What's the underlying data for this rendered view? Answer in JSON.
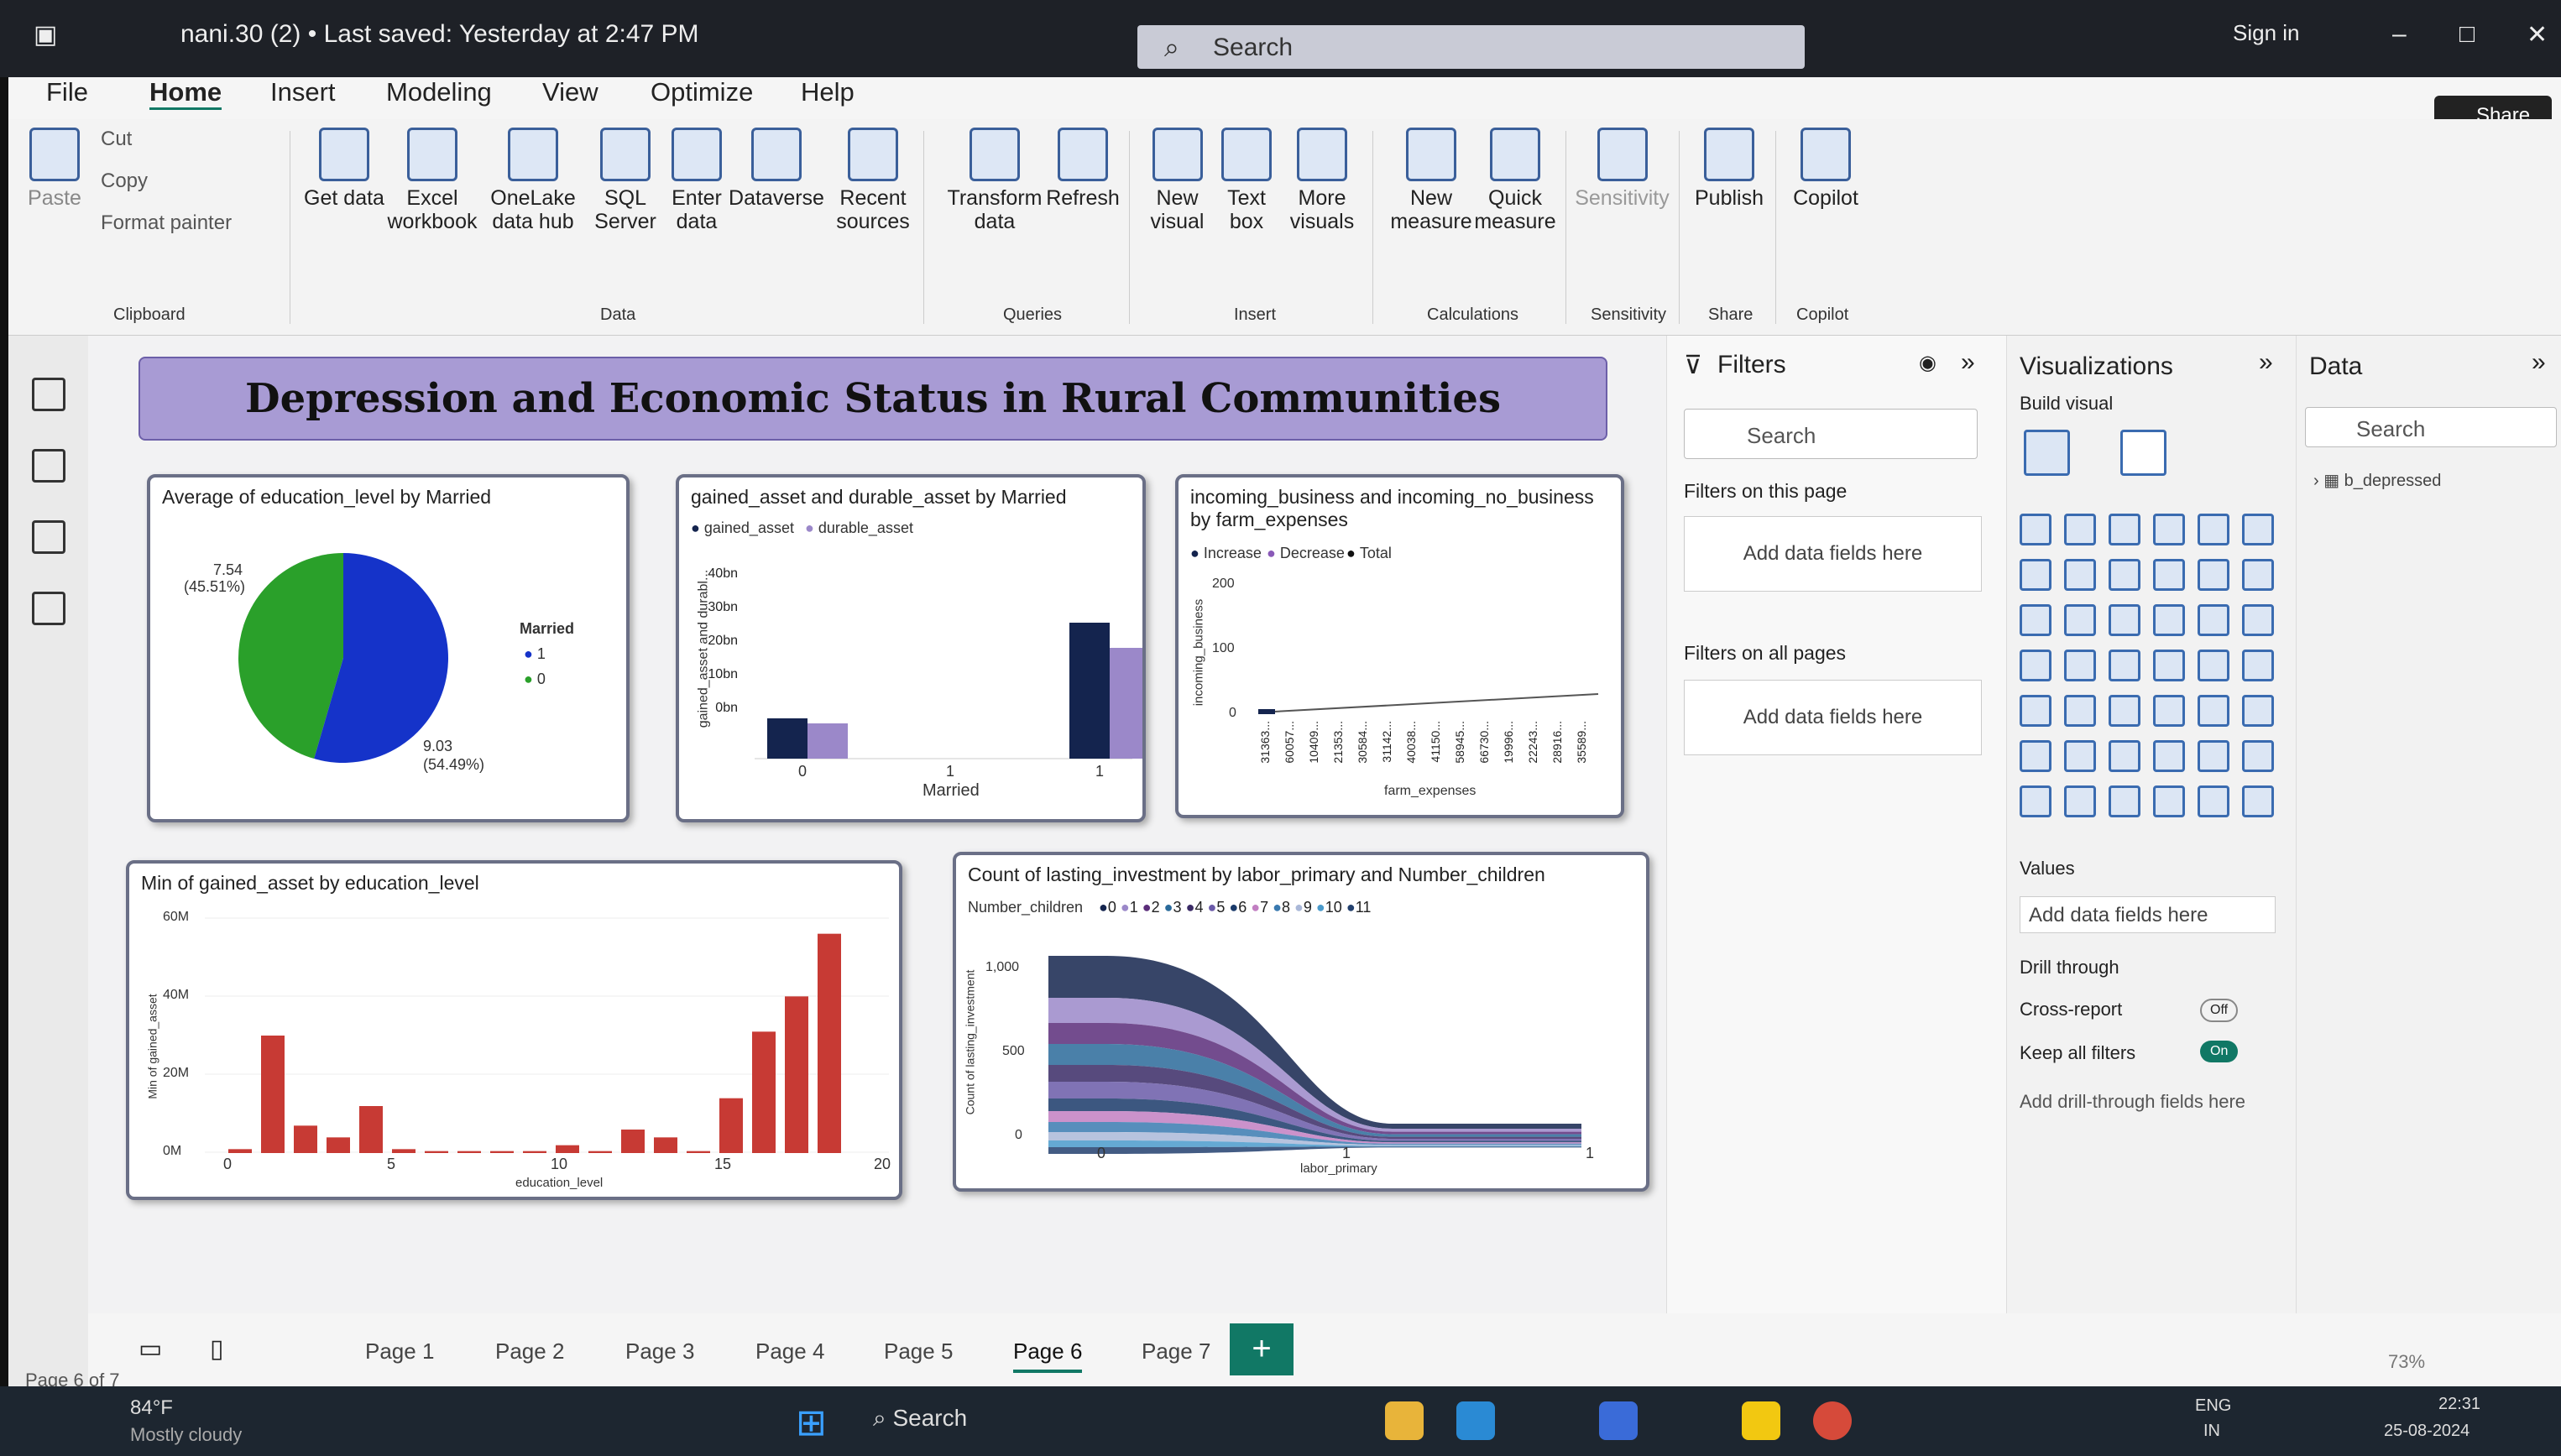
{
  "titlebar": {
    "doc_title": "nani.30 (2) • Last saved: Yesterday at 2:47 PM",
    "search_placeholder": "Search",
    "sign_in": "Sign in"
  },
  "menu": {
    "file": "File",
    "home": "Home",
    "insert": "Insert",
    "modeling": "Modeling",
    "view": "View",
    "optimize": "Optimize",
    "help": "Help",
    "share": "Share"
  },
  "ribbon": {
    "paste": "Paste",
    "cut": "Cut",
    "copy": "Copy",
    "format_painter": "Format painter",
    "clipboard": "Clipboard",
    "get_data": "Get data",
    "excel": "Excel workbook",
    "onelake": "OneLake data hub",
    "sql": "SQL Server",
    "enter_data": "Enter data",
    "dataverse": "Dataverse",
    "recent": "Recent sources",
    "data": "Data",
    "transform": "Transform data",
    "refresh": "Refresh",
    "queries": "Queries",
    "new_visual": "New visual",
    "text_box": "Text box",
    "more_visuals": "More visuals",
    "insert": "Insert",
    "new_measure": "New measure",
    "quick_measure": "Quick measure",
    "calculations": "Calculations",
    "sensitivity": "Sensitivity",
    "sensitivity_grp": "Sensitivity",
    "publish": "Publish",
    "share_grp": "Share",
    "copilot": "Copilot",
    "copilot_grp": "Copilot"
  },
  "report_title": "Depression and Economic Status in Rural Communities",
  "charts": {
    "pie": {
      "title": "Average of education_level by Married",
      "legend_title": "Married",
      "legend": [
        "1",
        "0"
      ],
      "label_a": "7.54",
      "label_a_pct": "(45.51%)",
      "label_b": "9.03",
      "label_b_pct": "(54.49%)"
    },
    "bar2": {
      "title": "gained_asset and durable_asset by Married",
      "legend": [
        "gained_asset",
        "durable_asset"
      ],
      "ylabel": "gained_asset and durabl...",
      "xlabel": "Married",
      "yticks": [
        "40bn",
        "30bn",
        "20bn",
        "10bn",
        "0bn"
      ],
      "xticks": [
        "0",
        "1",
        "1"
      ]
    },
    "waterfall": {
      "title": "incoming_business and incoming_no_business by farm_expenses",
      "legend": [
        "Increase",
        "Decrease",
        "Total"
      ],
      "ylabel": "incoming_business",
      "xlabel": "farm_expenses",
      "yticks": [
        "200",
        "100",
        "0"
      ],
      "xticks": [
        "31363...",
        "60057...",
        "10409...",
        "21353...",
        "30584...",
        "31142...",
        "40038...",
        "41150...",
        "58945...",
        "66730...",
        "19996...",
        "22243...",
        "28916...",
        "35589..."
      ]
    },
    "redbar": {
      "title": "Min of gained_asset by education_level",
      "ylabel": "Min of gained_asset",
      "xlabel": "education_level",
      "yticks": [
        "60M",
        "40M",
        "20M",
        "0M"
      ],
      "xticks": [
        "0",
        "5",
        "10",
        "15",
        "20"
      ]
    },
    "ribbon": {
      "title": "Count of lasting_investment by labor_primary and Number_children",
      "legend_title": "Number_children",
      "legend": [
        "0",
        "1",
        "2",
        "3",
        "4",
        "5",
        "6",
        "7",
        "8",
        "9",
        "10",
        "11"
      ],
      "ylabel": "Count of lasting_investment",
      "xlabel": "labor_primary",
      "yticks": [
        "1,000",
        "500",
        "0"
      ],
      "xticks": [
        "0",
        "1",
        "1"
      ]
    }
  },
  "chart_data": [
    {
      "type": "pie",
      "title": "Average of education_level by Married",
      "categories": [
        "0",
        "1"
      ],
      "values": [
        7.54,
        9.03
      ],
      "colors": [
        "#2aa02a",
        "#1533c9"
      ]
    },
    {
      "type": "bar",
      "title": "gained_asset and durable_asset by Married",
      "categories": [
        "0",
        "1"
      ],
      "series": [
        {
          "name": "gained_asset",
          "values": [
            8,
            27
          ]
        },
        {
          "name": "durable_asset",
          "values": [
            7,
            22
          ]
        }
      ],
      "ylim": [
        0,
        40
      ],
      "unit": "bn"
    },
    {
      "type": "bar",
      "title": "Min of gained_asset by education_level",
      "categories": [
        "0",
        "1",
        "2",
        "3",
        "4",
        "5",
        "6",
        "7",
        "8",
        "9",
        "10",
        "11",
        "12",
        "13",
        "14",
        "15",
        "16",
        "17",
        "18",
        "19"
      ],
      "values": [
        1,
        30,
        7,
        4,
        12,
        1,
        0.5,
        0.5,
        0.5,
        0.5,
        2,
        0.5,
        6,
        4,
        0.5,
        14,
        31,
        40,
        56,
        0
      ],
      "ylim": [
        0,
        60
      ],
      "unit": "M"
    }
  ],
  "filters": {
    "title": "Filters",
    "search": "Search",
    "on_page": "Filters on this page",
    "add1": "Add data fields here",
    "on_all": "Filters on all pages",
    "add2": "Add data fields here"
  },
  "viz": {
    "title": "Visualizations",
    "build": "Build visual",
    "values": "Values",
    "add_values": "Add data fields here",
    "drill": "Drill through",
    "cross": "Cross-report",
    "keep": "Keep all filters",
    "add_drill": "Add drill-through fields here",
    "off": "Off",
    "on": "On"
  },
  "datapane": {
    "title": "Data",
    "search": "Search",
    "table": "b_depressed"
  },
  "tabs": [
    "Page 1",
    "Page 2",
    "Page 3",
    "Page 4",
    "Page 5",
    "Page 6",
    "Page 7"
  ],
  "page_status": "Page 6 of 7",
  "zoom": "73%",
  "taskbar": {
    "temp": "84°F",
    "weather": "Mostly cloudy",
    "search": "Search",
    "lang": "ENG",
    "region": "IN",
    "time": "22:31",
    "date": "25-08-2024"
  }
}
